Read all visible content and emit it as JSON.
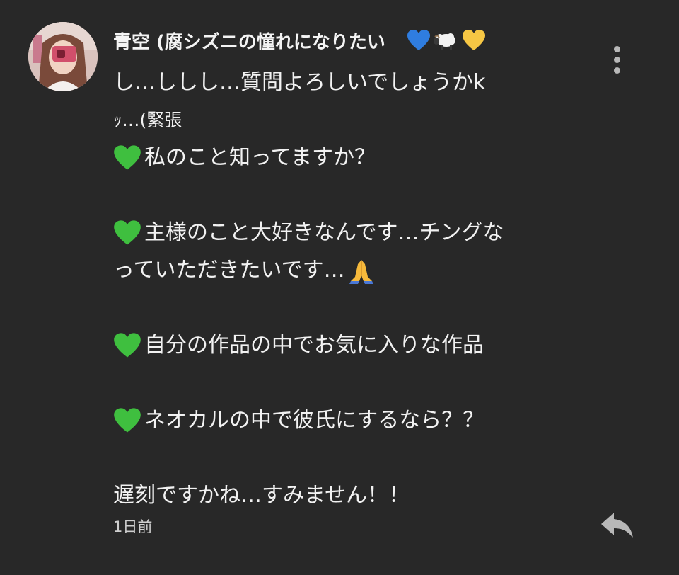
{
  "comment": {
    "username": "青空 (腐シズニの憧れになりたい",
    "badge_icons": [
      "blue-heart-icon",
      "sheep-icon",
      "yellow-heart-icon"
    ],
    "lines": {
      "l1": "し…ししし…質問よろしいでしょうかk",
      "l2": "ｯ…(緊張",
      "l3": "私のこと知ってますか？",
      "l4": "主様のこと大好きなんです…チングな",
      "l5": "っていただきたいです…",
      "l6": "自分の作品の中でお気に入りな作品",
      "l7": "ネオカルの中で彼氏にするなら？？",
      "l8": "遅刻ですかね…すみません！！"
    },
    "inline_icons": {
      "bullet": "green-heart-icon",
      "pray": "folded-hands-icon"
    },
    "timestamp": "1日前",
    "actions": {
      "more_icon": "more-vertical-icon",
      "reply_icon": "reply-arrow-icon"
    }
  },
  "colors": {
    "background": "#282828",
    "text": "#f2f2f2",
    "secondary_text": "#cfcfcf",
    "icon_gray": "#b8b8b8",
    "green_heart": "#3fbf3f",
    "blue_heart": "#2f7de0",
    "yellow_heart": "#f7c744"
  }
}
